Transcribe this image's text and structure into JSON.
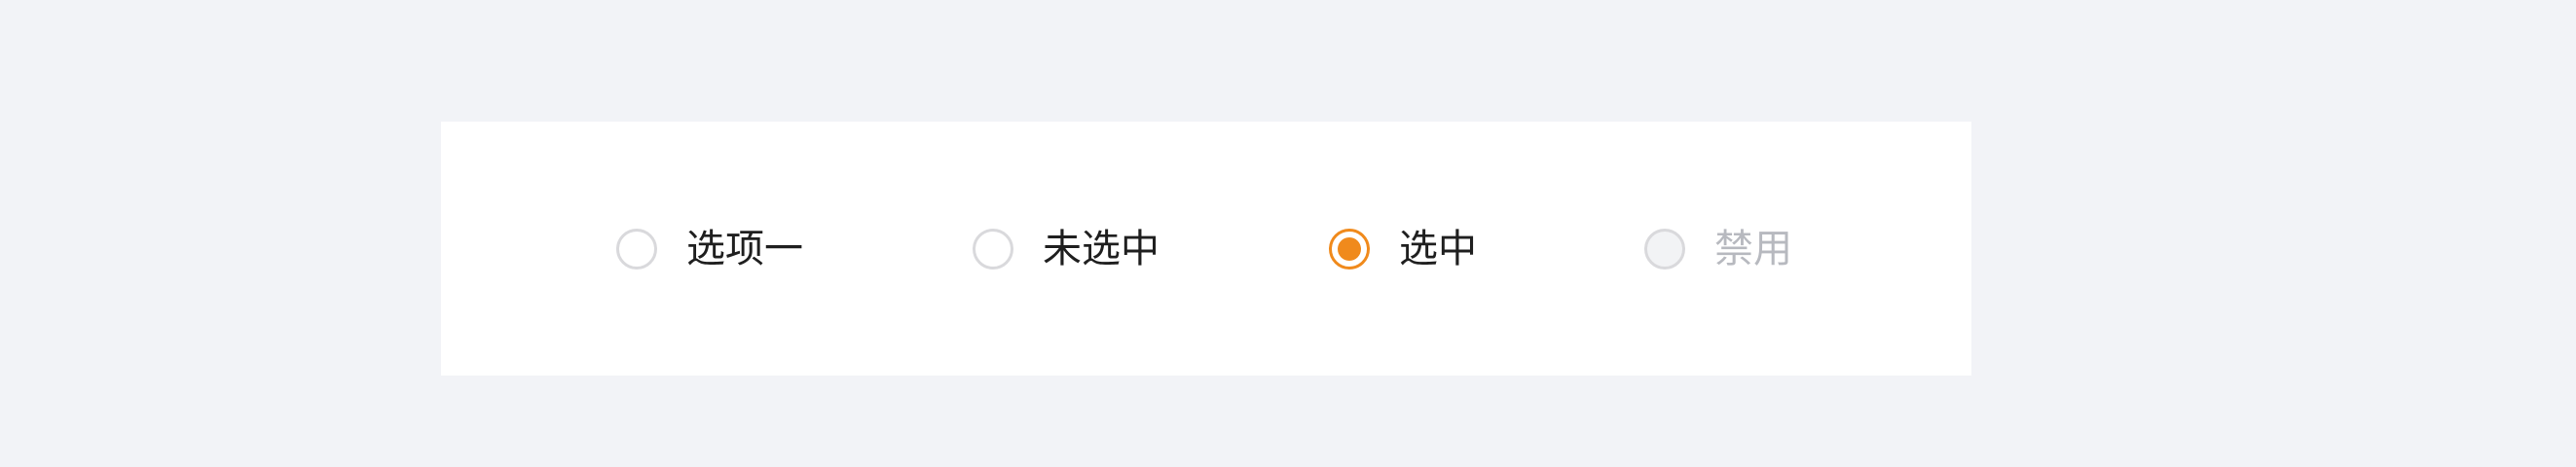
{
  "accent_color": "#f08a1c",
  "radio_group": {
    "options": [
      {
        "label": "选项一",
        "checked": false,
        "disabled": false
      },
      {
        "label": "未选中",
        "checked": false,
        "disabled": false
      },
      {
        "label": "选中",
        "checked": true,
        "disabled": false
      },
      {
        "label": "禁用",
        "checked": false,
        "disabled": true
      }
    ]
  }
}
